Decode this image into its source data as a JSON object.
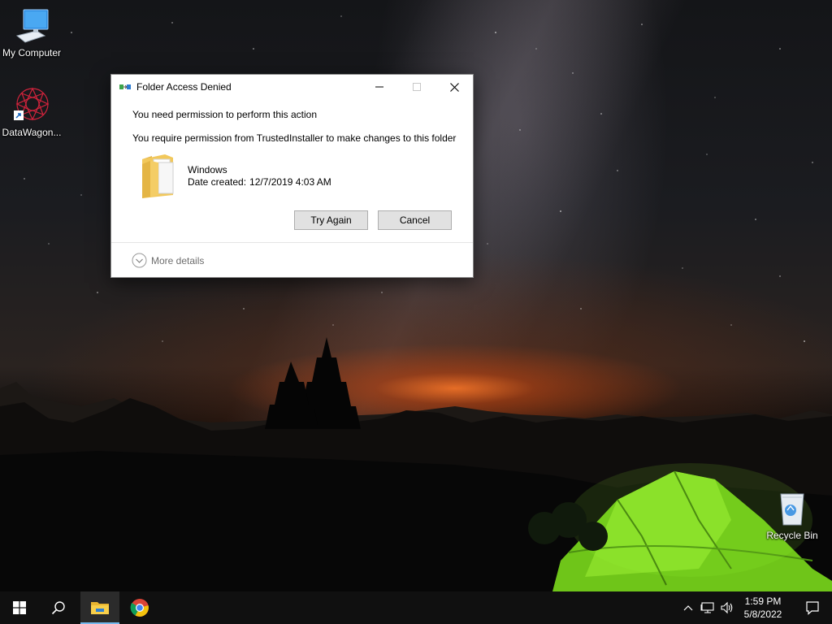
{
  "desktop": {
    "icons": [
      {
        "label": "My Computer"
      },
      {
        "label": "DataWagon..."
      },
      {
        "label": "Recycle Bin"
      }
    ]
  },
  "dialog": {
    "title": "Folder Access Denied",
    "heading": "You need permission to perform this action",
    "message": "You require permission from TrustedInstaller to make changes to this folder",
    "item": {
      "name": "Windows",
      "date_label": "Date created:",
      "date_value": "12/7/2019 4:03 AM"
    },
    "buttons": {
      "try_again": "Try Again",
      "cancel": "Cancel"
    },
    "more_details": "More details"
  },
  "taskbar": {
    "pinned": [
      {
        "icon": "windows-start-icon"
      },
      {
        "icon": "search-icon"
      },
      {
        "icon": "file-explorer-icon",
        "active": true
      },
      {
        "icon": "chrome-icon"
      }
    ],
    "tray": [
      "chevron-up-icon",
      "network-icon",
      "volume-icon"
    ],
    "clock": {
      "time": "1:59 PM",
      "date": "5/8/2022"
    }
  },
  "colors": {
    "taskbar": "#101010",
    "accent": "#76b9ed",
    "tent": "#7ed321"
  }
}
